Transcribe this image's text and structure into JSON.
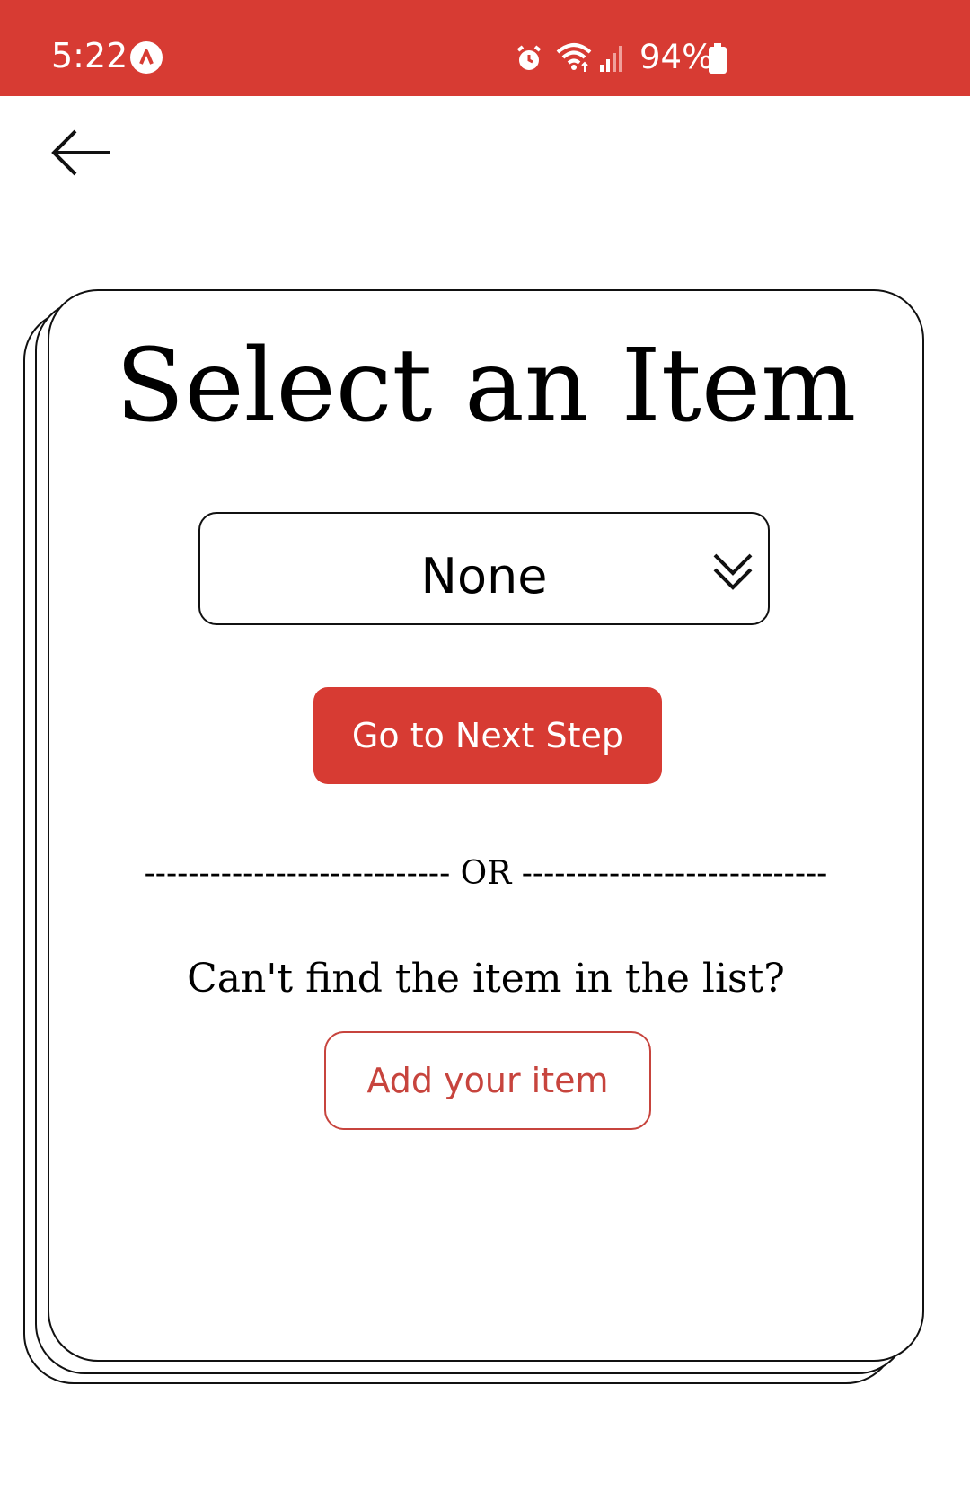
{
  "status_bar": {
    "time": "5:22",
    "battery": "94%",
    "app_icon": "assistant-icon",
    "icons": [
      "alarm-icon",
      "wifi-icon",
      "signal-icon",
      "battery-icon"
    ],
    "color": "#d73b33"
  },
  "nav": {
    "back_icon": "back-arrow-icon"
  },
  "card": {
    "title": "Select an Item",
    "dropdown": {
      "selected": "None",
      "icon": "double-chevron-down-icon"
    },
    "next_button": "Go to Next Step",
    "or_divider": "---------------------------- OR ----------------------------",
    "cant_find_text": "Can't find the item in the list?",
    "add_button": "Add your item"
  },
  "colors": {
    "accent": "#d73b33",
    "outline_accent": "#c7443d"
  }
}
